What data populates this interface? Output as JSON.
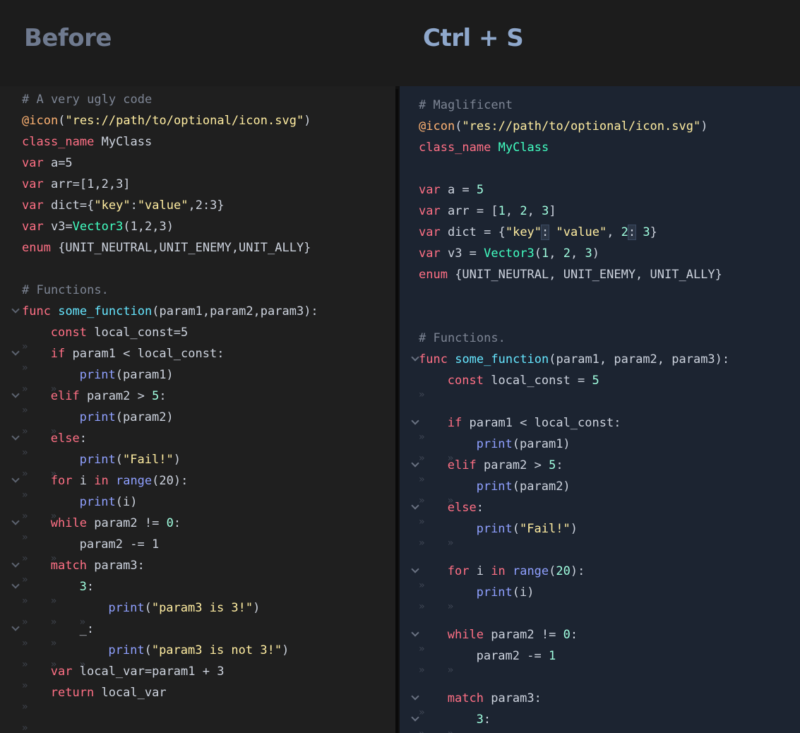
{
  "header": {
    "before_title": "Before",
    "after_title": "Ctrl + S"
  },
  "colors": {
    "comment": "#7d8594",
    "keyword": "#ff7085",
    "function": "#57b3ff",
    "builtin": "#8fa0ff",
    "string": "#ffeda1",
    "number": "#a1ffe0",
    "annotation": "#ffb373",
    "type": "#42ffc2"
  },
  "before_code": [
    {
      "fold": false,
      "indent": 0,
      "tokens": [
        [
          "cm",
          "# A very ugly code"
        ]
      ]
    },
    {
      "fold": false,
      "indent": 0,
      "tokens": [
        [
          "an",
          "@icon"
        ],
        [
          "",
          "("
        ],
        [
          "st",
          "\"res://path/to/optional/icon.svg\""
        ],
        [
          "",
          ")"
        ]
      ]
    },
    {
      "fold": false,
      "indent": 0,
      "tokens": [
        [
          "kw",
          "class_name"
        ],
        [
          "",
          " MyClass"
        ]
      ]
    },
    {
      "fold": false,
      "indent": 0,
      "tokens": [
        [
          "kw",
          "var"
        ],
        [
          "",
          " a=5"
        ]
      ]
    },
    {
      "fold": false,
      "indent": 0,
      "tokens": [
        [
          "kw",
          "var"
        ],
        [
          "",
          " arr=[1,2,3]"
        ]
      ]
    },
    {
      "fold": false,
      "indent": 0,
      "tokens": [
        [
          "kw",
          "var"
        ],
        [
          "",
          " dict={"
        ],
        [
          "st",
          "\"key\""
        ],
        [
          "",
          ":"
        ],
        [
          "st",
          "\"value\""
        ],
        [
          "",
          ",2:3}"
        ]
      ]
    },
    {
      "fold": false,
      "indent": 0,
      "tokens": [
        [
          "kw",
          "var"
        ],
        [
          "",
          " v3="
        ],
        [
          "ty",
          "Vector3"
        ],
        [
          "",
          "(1,2,3)"
        ]
      ]
    },
    {
      "fold": false,
      "indent": 0,
      "tokens": [
        [
          "kw",
          "enum"
        ],
        [
          "",
          " {UNIT_NEUTRAL,UNIT_ENEMY,UNIT_ALLY}"
        ]
      ]
    },
    {
      "fold": false,
      "indent": 0,
      "tokens": []
    },
    {
      "fold": false,
      "indent": 0,
      "tokens": [
        [
          "cm",
          "# Functions."
        ]
      ]
    },
    {
      "fold": true,
      "indent": 0,
      "tokens": [
        [
          "kw",
          "func"
        ],
        [
          "",
          " "
        ],
        [
          "df",
          "some_function"
        ],
        [
          "",
          "(param1,param2,param3):"
        ]
      ]
    },
    {
      "fold": false,
      "indent": 1,
      "tokens": [
        [
          "kw",
          "const"
        ],
        [
          "",
          " local_const=5"
        ]
      ]
    },
    {
      "fold": true,
      "indent": 1,
      "tokens": [
        [
          "kw",
          "if"
        ],
        [
          "",
          " param1 < local_const:"
        ]
      ]
    },
    {
      "fold": false,
      "indent": 2,
      "tokens": [
        [
          "bf",
          "print"
        ],
        [
          "",
          "(param1)"
        ]
      ]
    },
    {
      "fold": true,
      "indent": 1,
      "tokens": [
        [
          "kw",
          "elif"
        ],
        [
          "",
          " param2 > "
        ],
        [
          "nm",
          "5"
        ],
        [
          "",
          ":"
        ]
      ]
    },
    {
      "fold": false,
      "indent": 2,
      "tokens": [
        [
          "bf",
          "print"
        ],
        [
          "",
          "(param2)"
        ]
      ]
    },
    {
      "fold": true,
      "indent": 1,
      "tokens": [
        [
          "kw",
          "else"
        ],
        [
          "",
          ":"
        ]
      ]
    },
    {
      "fold": false,
      "indent": 2,
      "tokens": [
        [
          "bf",
          "print"
        ],
        [
          "",
          "("
        ],
        [
          "st",
          "\"Fail!\""
        ],
        [
          "",
          ")"
        ]
      ]
    },
    {
      "fold": true,
      "indent": 1,
      "tokens": [
        [
          "kw",
          "for"
        ],
        [
          "",
          " i "
        ],
        [
          "kw",
          "in"
        ],
        [
          "",
          " "
        ],
        [
          "bf",
          "range"
        ],
        [
          "",
          "(20):"
        ]
      ]
    },
    {
      "fold": false,
      "indent": 2,
      "tokens": [
        [
          "bf",
          "print"
        ],
        [
          "",
          "(i)"
        ]
      ]
    },
    {
      "fold": true,
      "indent": 1,
      "tokens": [
        [
          "kw",
          "while"
        ],
        [
          "",
          " param2 != "
        ],
        [
          "nm",
          "0"
        ],
        [
          "",
          ":"
        ]
      ]
    },
    {
      "fold": false,
      "indent": 2,
      "tokens": [
        [
          "",
          "param2 -= 1"
        ]
      ]
    },
    {
      "fold": true,
      "indent": 1,
      "tokens": [
        [
          "kw",
          "match"
        ],
        [
          "",
          " param3:"
        ]
      ]
    },
    {
      "fold": true,
      "indent": 2,
      "tokens": [
        [
          "nm",
          "3"
        ],
        [
          "",
          ":"
        ]
      ]
    },
    {
      "fold": false,
      "indent": 3,
      "tokens": [
        [
          "bf",
          "print"
        ],
        [
          "",
          "("
        ],
        [
          "st",
          "\"param3 is 3!\""
        ],
        [
          "",
          ")"
        ]
      ]
    },
    {
      "fold": true,
      "indent": 2,
      "tokens": [
        [
          "",
          "_:"
        ]
      ]
    },
    {
      "fold": false,
      "indent": 3,
      "tokens": [
        [
          "bf",
          "print"
        ],
        [
          "",
          "("
        ],
        [
          "st",
          "\"param3 is not 3!\""
        ],
        [
          "",
          ")"
        ]
      ]
    },
    {
      "fold": false,
      "indent": 1,
      "tokens": [
        [
          "kw",
          "var"
        ],
        [
          "",
          " local_var=param1 + 3"
        ]
      ]
    },
    {
      "fold": false,
      "indent": 1,
      "tokens": [
        [
          "kw",
          "return"
        ],
        [
          "",
          " local_var"
        ]
      ]
    },
    {
      "fold": false,
      "indent": 1,
      "tokens": []
    },
    {
      "fold": false,
      "indent": 1,
      "tokens": []
    }
  ],
  "after_code": [
    {
      "fold": false,
      "indent": 0,
      "tokens": [
        [
          "cm",
          "# Maglificent"
        ]
      ]
    },
    {
      "fold": false,
      "indent": 0,
      "tokens": [
        [
          "an",
          "@icon"
        ],
        [
          "",
          "("
        ],
        [
          "st",
          "\"res://path/to/optional/icon.svg\""
        ],
        [
          "",
          ")"
        ]
      ]
    },
    {
      "fold": false,
      "indent": 0,
      "tokens": [
        [
          "kw",
          "class_name"
        ],
        [
          "",
          " "
        ],
        [
          "ty",
          "MyClass"
        ]
      ]
    },
    {
      "fold": false,
      "indent": 0,
      "tokens": []
    },
    {
      "fold": false,
      "indent": 0,
      "tokens": [
        [
          "kw",
          "var"
        ],
        [
          "",
          " a = "
        ],
        [
          "nm",
          "5"
        ]
      ]
    },
    {
      "fold": false,
      "indent": 0,
      "tokens": [
        [
          "kw",
          "var"
        ],
        [
          "",
          " arr = ["
        ],
        [
          "nm",
          "1"
        ],
        [
          "",
          ", "
        ],
        [
          "nm",
          "2"
        ],
        [
          "",
          ", "
        ],
        [
          "nm",
          "3"
        ],
        [
          "",
          "]"
        ]
      ]
    },
    {
      "fold": false,
      "indent": 0,
      "tokens": [
        [
          "kw",
          "var"
        ],
        [
          "",
          " dict = {"
        ],
        [
          "st",
          "\"key\""
        ],
        [
          "hl",
          ":"
        ],
        [
          "",
          " "
        ],
        [
          "st",
          "\"value\""
        ],
        [
          "",
          ", "
        ],
        [
          "nm",
          "2"
        ],
        [
          "hl",
          ":"
        ],
        [
          "",
          " "
        ],
        [
          "nm",
          "3"
        ],
        [
          "",
          "}"
        ]
      ]
    },
    {
      "fold": false,
      "indent": 0,
      "tokens": [
        [
          "kw",
          "var"
        ],
        [
          "",
          " v3 = "
        ],
        [
          "ty",
          "Vector3"
        ],
        [
          "",
          "("
        ],
        [
          "nm",
          "1"
        ],
        [
          "",
          ", "
        ],
        [
          "nm",
          "2"
        ],
        [
          "",
          ", "
        ],
        [
          "nm",
          "3"
        ],
        [
          "",
          ")"
        ]
      ]
    },
    {
      "fold": false,
      "indent": 0,
      "tokens": [
        [
          "kw",
          "enum"
        ],
        [
          "",
          " {UNIT_NEUTRAL, UNIT_ENEMY, UNIT_ALLY}"
        ]
      ]
    },
    {
      "fold": false,
      "indent": 0,
      "tokens": []
    },
    {
      "fold": false,
      "indent": 0,
      "tokens": []
    },
    {
      "fold": false,
      "indent": 0,
      "tokens": [
        [
          "cm",
          "# Functions."
        ]
      ]
    },
    {
      "fold": true,
      "indent": 0,
      "tokens": [
        [
          "kw",
          "func"
        ],
        [
          "",
          " "
        ],
        [
          "df",
          "some_function"
        ],
        [
          "",
          "(param1, param2, param3):"
        ]
      ]
    },
    {
      "fold": false,
      "indent": 1,
      "tokens": [
        [
          "kw",
          "const"
        ],
        [
          "",
          " local_const = "
        ],
        [
          "nm",
          "5"
        ]
      ]
    },
    {
      "fold": false,
      "indent": 0,
      "tokens": []
    },
    {
      "fold": true,
      "indent": 1,
      "tokens": [
        [
          "kw",
          "if"
        ],
        [
          "",
          " param1 < local_const:"
        ]
      ]
    },
    {
      "fold": false,
      "indent": 2,
      "tokens": [
        [
          "bf",
          "print"
        ],
        [
          "",
          "(param1)"
        ]
      ]
    },
    {
      "fold": true,
      "indent": 1,
      "tokens": [
        [
          "kw",
          "elif"
        ],
        [
          "",
          " param2 > "
        ],
        [
          "nm",
          "5"
        ],
        [
          "",
          ":"
        ]
      ]
    },
    {
      "fold": false,
      "indent": 2,
      "tokens": [
        [
          "bf",
          "print"
        ],
        [
          "",
          "(param2)"
        ]
      ]
    },
    {
      "fold": true,
      "indent": 1,
      "tokens": [
        [
          "kw",
          "else"
        ],
        [
          "",
          ":"
        ]
      ]
    },
    {
      "fold": false,
      "indent": 2,
      "tokens": [
        [
          "bf",
          "print"
        ],
        [
          "",
          "("
        ],
        [
          "st",
          "\"Fail!\""
        ],
        [
          "",
          ")"
        ]
      ]
    },
    {
      "fold": false,
      "indent": 0,
      "tokens": []
    },
    {
      "fold": true,
      "indent": 1,
      "tokens": [
        [
          "kw",
          "for"
        ],
        [
          "",
          " i "
        ],
        [
          "kw",
          "in"
        ],
        [
          "",
          " "
        ],
        [
          "bf",
          "range"
        ],
        [
          "",
          "("
        ],
        [
          "nm",
          "20"
        ],
        [
          "",
          "):"
        ]
      ]
    },
    {
      "fold": false,
      "indent": 2,
      "tokens": [
        [
          "bf",
          "print"
        ],
        [
          "",
          "(i)"
        ]
      ]
    },
    {
      "fold": false,
      "indent": 0,
      "tokens": []
    },
    {
      "fold": true,
      "indent": 1,
      "tokens": [
        [
          "kw",
          "while"
        ],
        [
          "",
          " param2 != "
        ],
        [
          "nm",
          "0"
        ],
        [
          "",
          ":"
        ]
      ]
    },
    {
      "fold": false,
      "indent": 2,
      "tokens": [
        [
          "",
          "param2 -= "
        ],
        [
          "nm",
          "1"
        ]
      ]
    },
    {
      "fold": false,
      "indent": 0,
      "tokens": []
    },
    {
      "fold": true,
      "indent": 1,
      "tokens": [
        [
          "kw",
          "match"
        ],
        [
          "",
          " param3:"
        ]
      ]
    },
    {
      "fold": true,
      "indent": 2,
      "tokens": [
        [
          "nm",
          "3"
        ],
        [
          "",
          ":"
        ]
      ]
    }
  ]
}
